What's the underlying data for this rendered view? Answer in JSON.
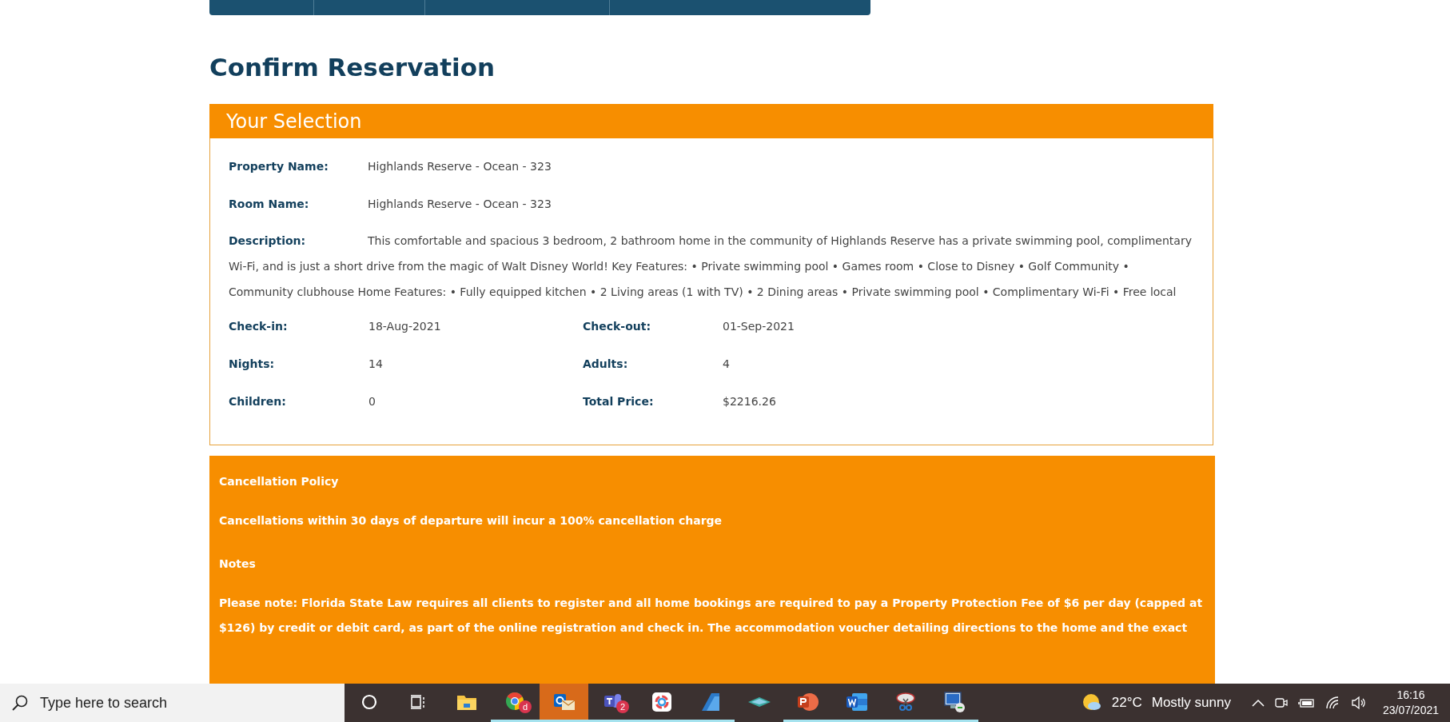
{
  "page_title": "Confirm Reservation",
  "selection": {
    "title": "Your Selection",
    "rows": [
      {
        "label": "Property Name:",
        "value": "Highlands Reserve - Ocean - 323"
      },
      {
        "label": "Room Name:",
        "value": "Highlands Reserve - Ocean - 323"
      },
      {
        "label": "Description:",
        "value": "This comfortable and spacious 3 bedroom, 2 bathroom home in the community of Highlands Reserve has a private swimming pool, complimentary Wi-Fi, and is just a short drive from the magic of Walt Disney World! Key Features: • Private swimming pool • Games room • Close to Disney • Golf Community • Community clubhouse Home Features: • Fully equipped kitchen • 2 Living areas (1 with TV) • 2 Dining areas • Private swimming pool • Complimentary Wi-Fi • Free local"
      }
    ],
    "details": [
      {
        "label": "Check-in:",
        "value": "18-Aug-2021"
      },
      {
        "label": "Check-out:",
        "value": "01-Sep-2021"
      },
      {
        "label": "Nights:",
        "value": "14"
      },
      {
        "label": "Adults:",
        "value": "4"
      },
      {
        "label": "Children:",
        "value": "0"
      },
      {
        "label": "Total Price:",
        "value": "$2216.26"
      }
    ]
  },
  "policy": {
    "sections": [
      {
        "heading": "Cancellation Policy",
        "text": "Cancellations within 30 days of departure will incur a 100% cancellation charge"
      },
      {
        "heading": "Notes",
        "text": "Please note: Florida State Law requires all clients to register and all home bookings are required to pay a Property Protection Fee of $6 per day (capped at $126) by credit or debit card, as part of the online registration and check in. The accommodation voucher detailing directions to the home and the exact"
      }
    ]
  },
  "taskbar": {
    "search_placeholder": "Type here to search",
    "apps": [
      {
        "kind": "cortana",
        "selected": false
      },
      {
        "kind": "taskview",
        "selected": false
      },
      {
        "kind": "folder",
        "selected": false,
        "running": false
      },
      {
        "kind": "chrome",
        "selected": false,
        "running": true,
        "badge": "d"
      },
      {
        "kind": "mail",
        "selected": true,
        "running": true
      },
      {
        "kind": "chat",
        "selected": false,
        "running": true,
        "badge": "2"
      },
      {
        "kind": "photos",
        "selected": false,
        "running": true
      },
      {
        "kind": "arrow",
        "selected": false,
        "running": true
      },
      {
        "kind": "layers",
        "selected": false,
        "running": false
      },
      {
        "kind": "slides",
        "selected": false,
        "running": true
      },
      {
        "kind": "doc",
        "selected": false,
        "running": true
      },
      {
        "kind": "scissors",
        "selected": false,
        "running": true
      },
      {
        "kind": "monitor",
        "selected": false,
        "running": true
      }
    ],
    "weather": {
      "temp": "22°C",
      "condition": "Mostly sunny"
    },
    "time": "16:16",
    "date": "23/07/2021"
  }
}
